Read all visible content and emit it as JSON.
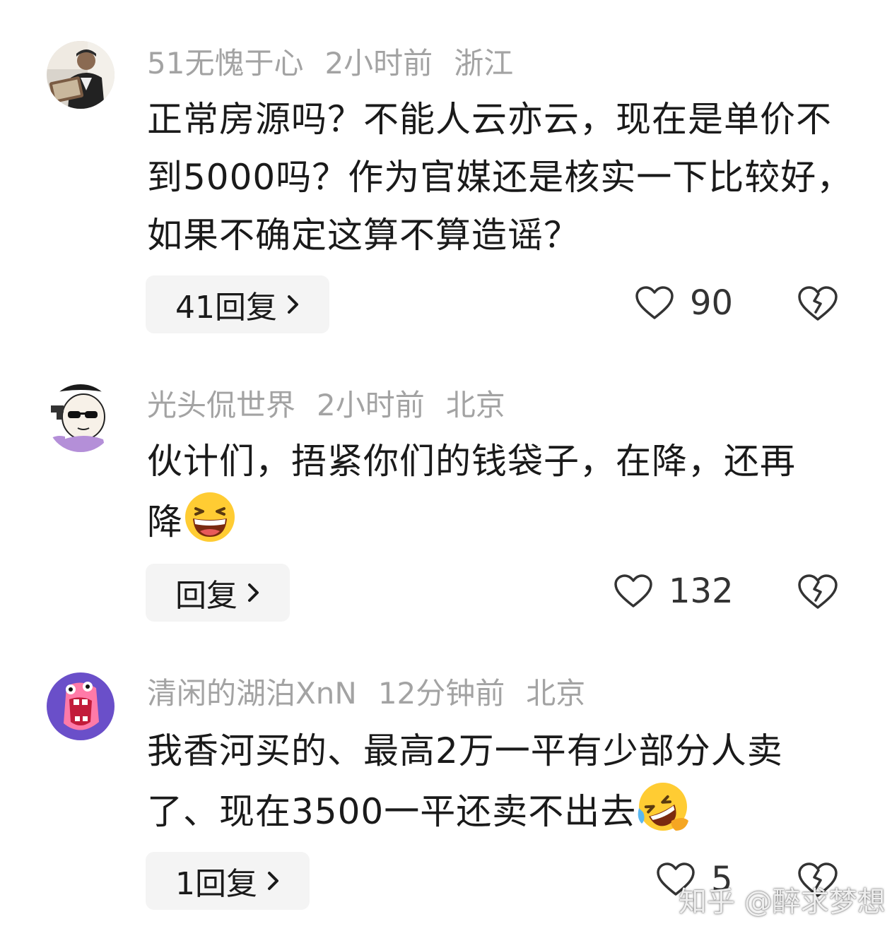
{
  "comments": [
    {
      "username": "51无愧于心",
      "time": "2小时前",
      "location": "浙江",
      "text": "正常房源吗？不能人云亦云，现在是单价不到5000吗？作为官媒还是核实一下比较好，如果不确定这算不算造谣？",
      "reply_label": "41回复",
      "likes": "90",
      "avatar_icon": "man-reading-photo-avatar",
      "emoji": ""
    },
    {
      "username": "光头侃世界",
      "time": "2小时前",
      "location": "北京",
      "text": "伙计们，捂紧你们的钱袋子，在降，还再降",
      "reply_label": "回复",
      "likes": "132",
      "avatar_icon": "bald-cartoon-sunglasses-avatar",
      "emoji": "grinning-squinting-face"
    },
    {
      "username": "清闲的湖泊XnN",
      "time": "12分钟前",
      "location": "北京",
      "text": "我香河买的、最高2万一平有少部分人卖了、现在3500一平还卖不出去",
      "reply_label": "1回复",
      "likes": "5",
      "avatar_icon": "screaming-cartoon-avatar",
      "emoji": "rolling-on-floor-laughing-face"
    }
  ],
  "watermark": "知乎 @醉求梦想",
  "colors": {
    "meta_text": "#a3a3a3",
    "body_text": "#1a1a1a",
    "reply_bg": "#f4f4f4",
    "icon_stroke": "#333333"
  }
}
